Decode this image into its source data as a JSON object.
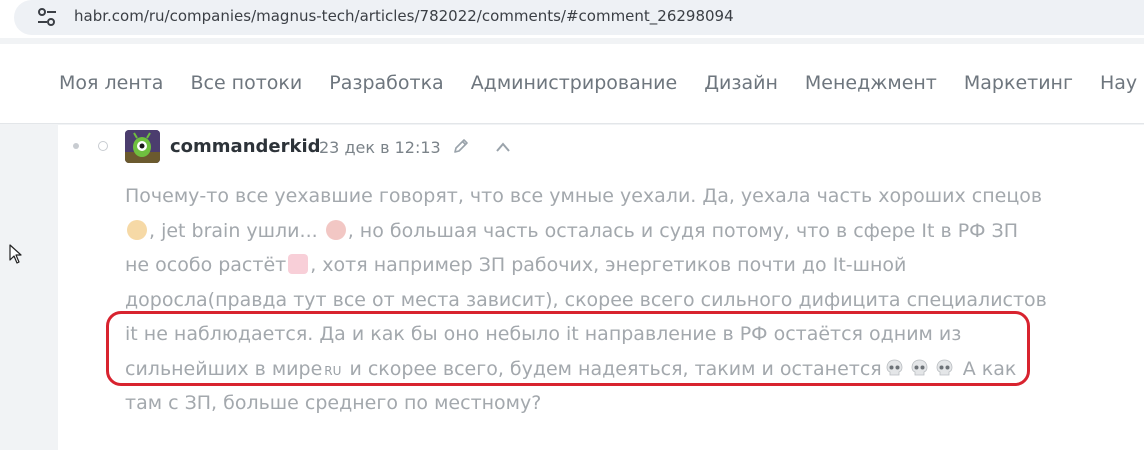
{
  "browser": {
    "url": "habr.com/ru/companies/magnus-tech/articles/782022/comments/#comment_26298094",
    "site_settings_icon": "tune-icon"
  },
  "nav": {
    "items": [
      {
        "label": "Моя лента"
      },
      {
        "label": "Все потоки"
      },
      {
        "label": "Разработка"
      },
      {
        "label": "Администрирование"
      },
      {
        "label": "Дизайн"
      },
      {
        "label": "Менеджмент"
      },
      {
        "label": "Маркетинг"
      },
      {
        "label": "Нау"
      }
    ]
  },
  "comment": {
    "author": "commanderkid",
    "timestamp": "23 дек в 12:13",
    "lines": [
      {
        "text": "Почему-то все уехавшие говорят, что все умные уехали. Да, уехала часть хороших спецов"
      },
      {
        "seg1": ", jet brain ушли... ",
        "seg2": ", но большая часть осталась и судя потому, что в сфере It в РФ ЗП"
      },
      {
        "seg1": "не особо растёт",
        "seg2": ", хотя например ЗП рабочих, энергетиков почти до It-шной"
      },
      {
        "text": "доросла(правда тут все от места зависит), скорее всего сильного дифицита специалистов"
      },
      {
        "text": "it не наблюдается. Да и как бы оно небыло it направление в РФ остаётся одним из"
      },
      {
        "seg1": "сильнейших в мире",
        "flag": "RU",
        "seg2": " и скорее всего, будем надеяться, таким и останется",
        "seg3": " А как"
      },
      {
        "text": "там с ЗП, больше среднего по местному?"
      }
    ],
    "emojis": [
      "pensive-face",
      "crying-face",
      "pig-face",
      "skull",
      "skull",
      "skull"
    ],
    "highlight_color": "#d8232f"
  }
}
